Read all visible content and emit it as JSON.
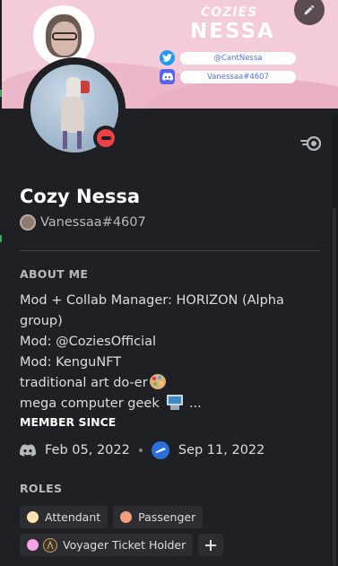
{
  "banner": {
    "brand": "COZIES",
    "name": "NESSA",
    "twitter_handle": "@CantNessa",
    "discord_handle": "Vanessaa#4607",
    "bg_color": "#f4cbd8"
  },
  "profile": {
    "display_name": "Cozy Nessa",
    "tag": "Vanessaa#4607",
    "status": "do-not-disturb",
    "status_color": "#ed4245"
  },
  "about": {
    "title": "ABOUT ME",
    "lines": [
      "Mod + Collab Manager: HORIZON (Alpha",
      "group)",
      "Mod: @CoziesOfficial",
      "Mod: KenguNFT",
      "traditional art do-er",
      "mega computer geek",
      "..."
    ],
    "emoji_palette": "artist-palette-icon",
    "emoji_computer": "desktop-computer-icon"
  },
  "member_since": {
    "title": "MEMBER SINCE",
    "discord_date": "Feb 05, 2022",
    "server_date": "Sep 11, 2022"
  },
  "roles": {
    "title": "ROLES",
    "items": [
      {
        "name": "Attendant",
        "color": "#fde3b0"
      },
      {
        "name": "Passenger",
        "color": "#f4a07c"
      },
      {
        "name": "Voyager Ticket Holder",
        "color": "#f8a3e6"
      }
    ],
    "add_icon": "plus-icon"
  },
  "colors": {
    "card_bg": "#1f2023",
    "role_bg": "#2b2d31",
    "accent": "#5865f2"
  }
}
